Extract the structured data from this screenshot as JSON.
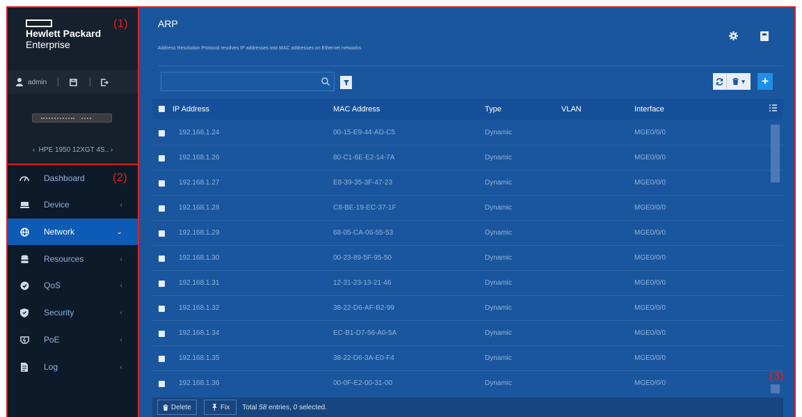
{
  "annotations": {
    "label1": "(1)",
    "label2": "(2)",
    "label3": "(3)"
  },
  "brand": {
    "line1": "Hewlett Packard",
    "line2": "Enterprise"
  },
  "user": {
    "name": "admin"
  },
  "device": {
    "name": "HPE 1950 12XGT 4S.."
  },
  "nav": {
    "items": [
      {
        "label": "Dashboard",
        "icon": "gauge-icon",
        "active": false
      },
      {
        "label": "Device",
        "icon": "device-icon",
        "active": false
      },
      {
        "label": "Network",
        "icon": "globe-icon",
        "active": true
      },
      {
        "label": "Resources",
        "icon": "database-icon",
        "active": false
      },
      {
        "label": "QoS",
        "icon": "qos-icon",
        "active": false
      },
      {
        "label": "Security",
        "icon": "shield-icon",
        "active": false
      },
      {
        "label": "PoE",
        "icon": "poe-icon",
        "active": false
      },
      {
        "label": "Log",
        "icon": "log-icon",
        "active": false
      }
    ]
  },
  "page": {
    "title": "ARP",
    "subtitle": "Address Resolution Protocol resolves IP addresses into MAC addresses on Ethernet networks."
  },
  "search": {
    "placeholder": "",
    "value": ""
  },
  "table": {
    "headers": {
      "ip": "IP Address",
      "mac": "MAC Address",
      "type": "Type",
      "vlan": "VLAN",
      "iface": "Interface"
    },
    "rows": [
      {
        "ip": "192.168.1.24",
        "mac": "00-15-E9-44-AD-C5",
        "type": "Dynamic",
        "vlan": "",
        "iface": "MGE0/0/0"
      },
      {
        "ip": "192.168.1.26",
        "mac": "80-C1-6E-E2-14-7A",
        "type": "Dynamic",
        "vlan": "",
        "iface": "MGE0/0/0"
      },
      {
        "ip": "192.168.1.27",
        "mac": "E8-39-35-3F-47-23",
        "type": "Dynamic",
        "vlan": "",
        "iface": "MGE0/0/0"
      },
      {
        "ip": "192.168.1.28",
        "mac": "C8-BE-19-EC-37-1F",
        "type": "Dynamic",
        "vlan": "",
        "iface": "MGE0/0/0"
      },
      {
        "ip": "192.168.1.29",
        "mac": "68-05-CA-06-55-53",
        "type": "Dynamic",
        "vlan": "",
        "iface": "MGE0/0/0"
      },
      {
        "ip": "192.168.1.30",
        "mac": "00-23-89-5F-95-50",
        "type": "Dynamic",
        "vlan": "",
        "iface": "MGE0/0/0"
      },
      {
        "ip": "192.168.1.31",
        "mac": "12-31-23-13-21-46",
        "type": "Dynamic",
        "vlan": "",
        "iface": "MGE0/0/0"
      },
      {
        "ip": "192.168.1.32",
        "mac": "38-22-D6-AF-B2-99",
        "type": "Dynamic",
        "vlan": "",
        "iface": "MGE0/0/0"
      },
      {
        "ip": "192.168.1.34",
        "mac": "EC-B1-D7-56-A0-5A",
        "type": "Dynamic",
        "vlan": "",
        "iface": "MGE0/0/0"
      },
      {
        "ip": "192.168.1.35",
        "mac": "38-22-D6-3A-E0-F4",
        "type": "Dynamic",
        "vlan": "",
        "iface": "MGE0/0/0"
      },
      {
        "ip": "192.168.1.36",
        "mac": "00-0F-E2-00-31-00",
        "type": "Dynamic",
        "vlan": "",
        "iface": "MGE0/0/0"
      }
    ]
  },
  "footer": {
    "delete_label": "Delete",
    "fix_label": "Fix",
    "total_prefix": "Total ",
    "total_count": "58",
    "total_mid": " entries, ",
    "selected_count": "0",
    "selected_suffix": " selected."
  },
  "colors": {
    "accent": "#0e5bb6",
    "sidebar": "#0d1a2a",
    "main": "#1a569d",
    "annotation": "#e01e1e"
  }
}
